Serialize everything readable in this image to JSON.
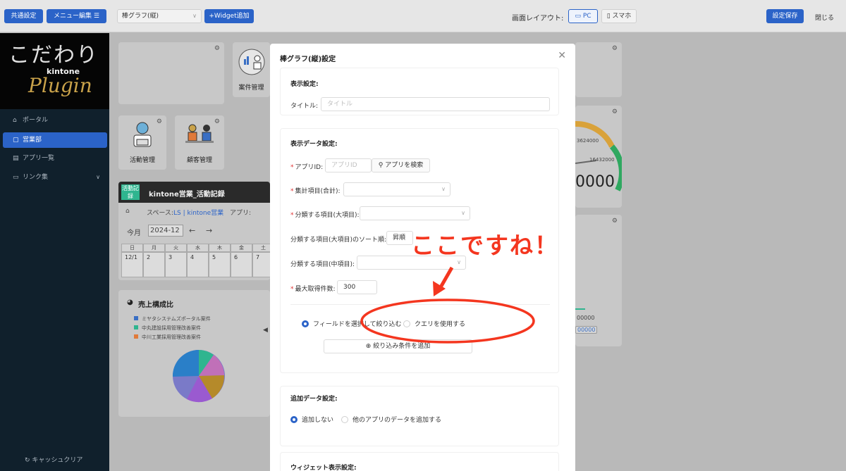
{
  "topbar": {
    "common_settings": "共通設定",
    "menu_edit": "メニュー編集",
    "widget_type": "棒グラフ(縦)",
    "add_widget": "+Widget追加",
    "layout_label": "画面レイアウト:",
    "layout_pc": "PC",
    "layout_phone": "スマホ",
    "save": "設定保存",
    "close": "閉じる"
  },
  "sidebar": {
    "logo_line1": "こだわり",
    "logo_line2": "kintone",
    "logo_line3": "Plugin",
    "items": [
      {
        "label": "ポータル",
        "icon": "home-icon"
      },
      {
        "label": "営業部",
        "icon": "document-icon"
      },
      {
        "label": "アプリ一覧",
        "icon": "list-icon"
      },
      {
        "label": "リンク集",
        "icon": "folder-icon"
      }
    ],
    "cache_clear": "キャッシュクリア"
  },
  "background": {
    "card_case": "案件管理",
    "card_activity": "活動管理",
    "card_customer": "顧客管理",
    "banner_badge": "活動記録",
    "banner_title": "kintone営業_活動記録",
    "breadcrumb_space": "スペース:",
    "breadcrumb_link": "LS | kintone営業",
    "breadcrumb_app": "アプリ:",
    "today": "今月",
    "month": "2024-12",
    "weekdays": [
      "日",
      "月",
      "火",
      "水",
      "木",
      "金",
      "土"
    ],
    "dates": [
      "12/1",
      "2",
      "3",
      "4",
      "5",
      "6",
      "7"
    ],
    "sales_title": "売上構成比",
    "legend": [
      {
        "label": "ミヤタシステムズポータル案件",
        "color": "#3a6fc4"
      },
      {
        "label": "中丸建設採用管理改善案件",
        "color": "#2fb58f"
      },
      {
        "label": "中川工業採用管理改善案件",
        "color": "#e07a3a"
      }
    ],
    "gauge_value1": "3624000",
    "gauge_value2": "16432000",
    "gauge_big": "0000",
    "right_value": "00000",
    "right_value2": "00000"
  },
  "modal": {
    "title": "棒グラフ(縦)設定",
    "display_section": "表示設定:",
    "title_label": "タイトル:",
    "title_placeholder": "タイトル",
    "data_section": "表示データ設定:",
    "app_id_label": "アプリID:",
    "app_id_placeholder": "アプリID",
    "search_app": "アプリを検索",
    "agg_label": "集計項目(合計):",
    "cat_label": "分類する項目(大項目):",
    "sort_label": "分類する項目(大項目)のソート順:",
    "sort_value": "昇順",
    "subcat_label": "分類する項目(中項目):",
    "max_label": "最大取得件数:",
    "max_value": "300",
    "filter_field": "フィールドを選択して絞り込む",
    "filter_query": "クエリを使用する",
    "add_condition": "絞り込み条件を追加",
    "extra_section": "追加データ設定:",
    "extra_none": "追加しない",
    "extra_other": "他のアプリのデータを追加する",
    "widget_section": "ウィジェット表示設定:"
  },
  "annotation": {
    "callout": "ここですね！",
    "color": "#f4361f"
  }
}
